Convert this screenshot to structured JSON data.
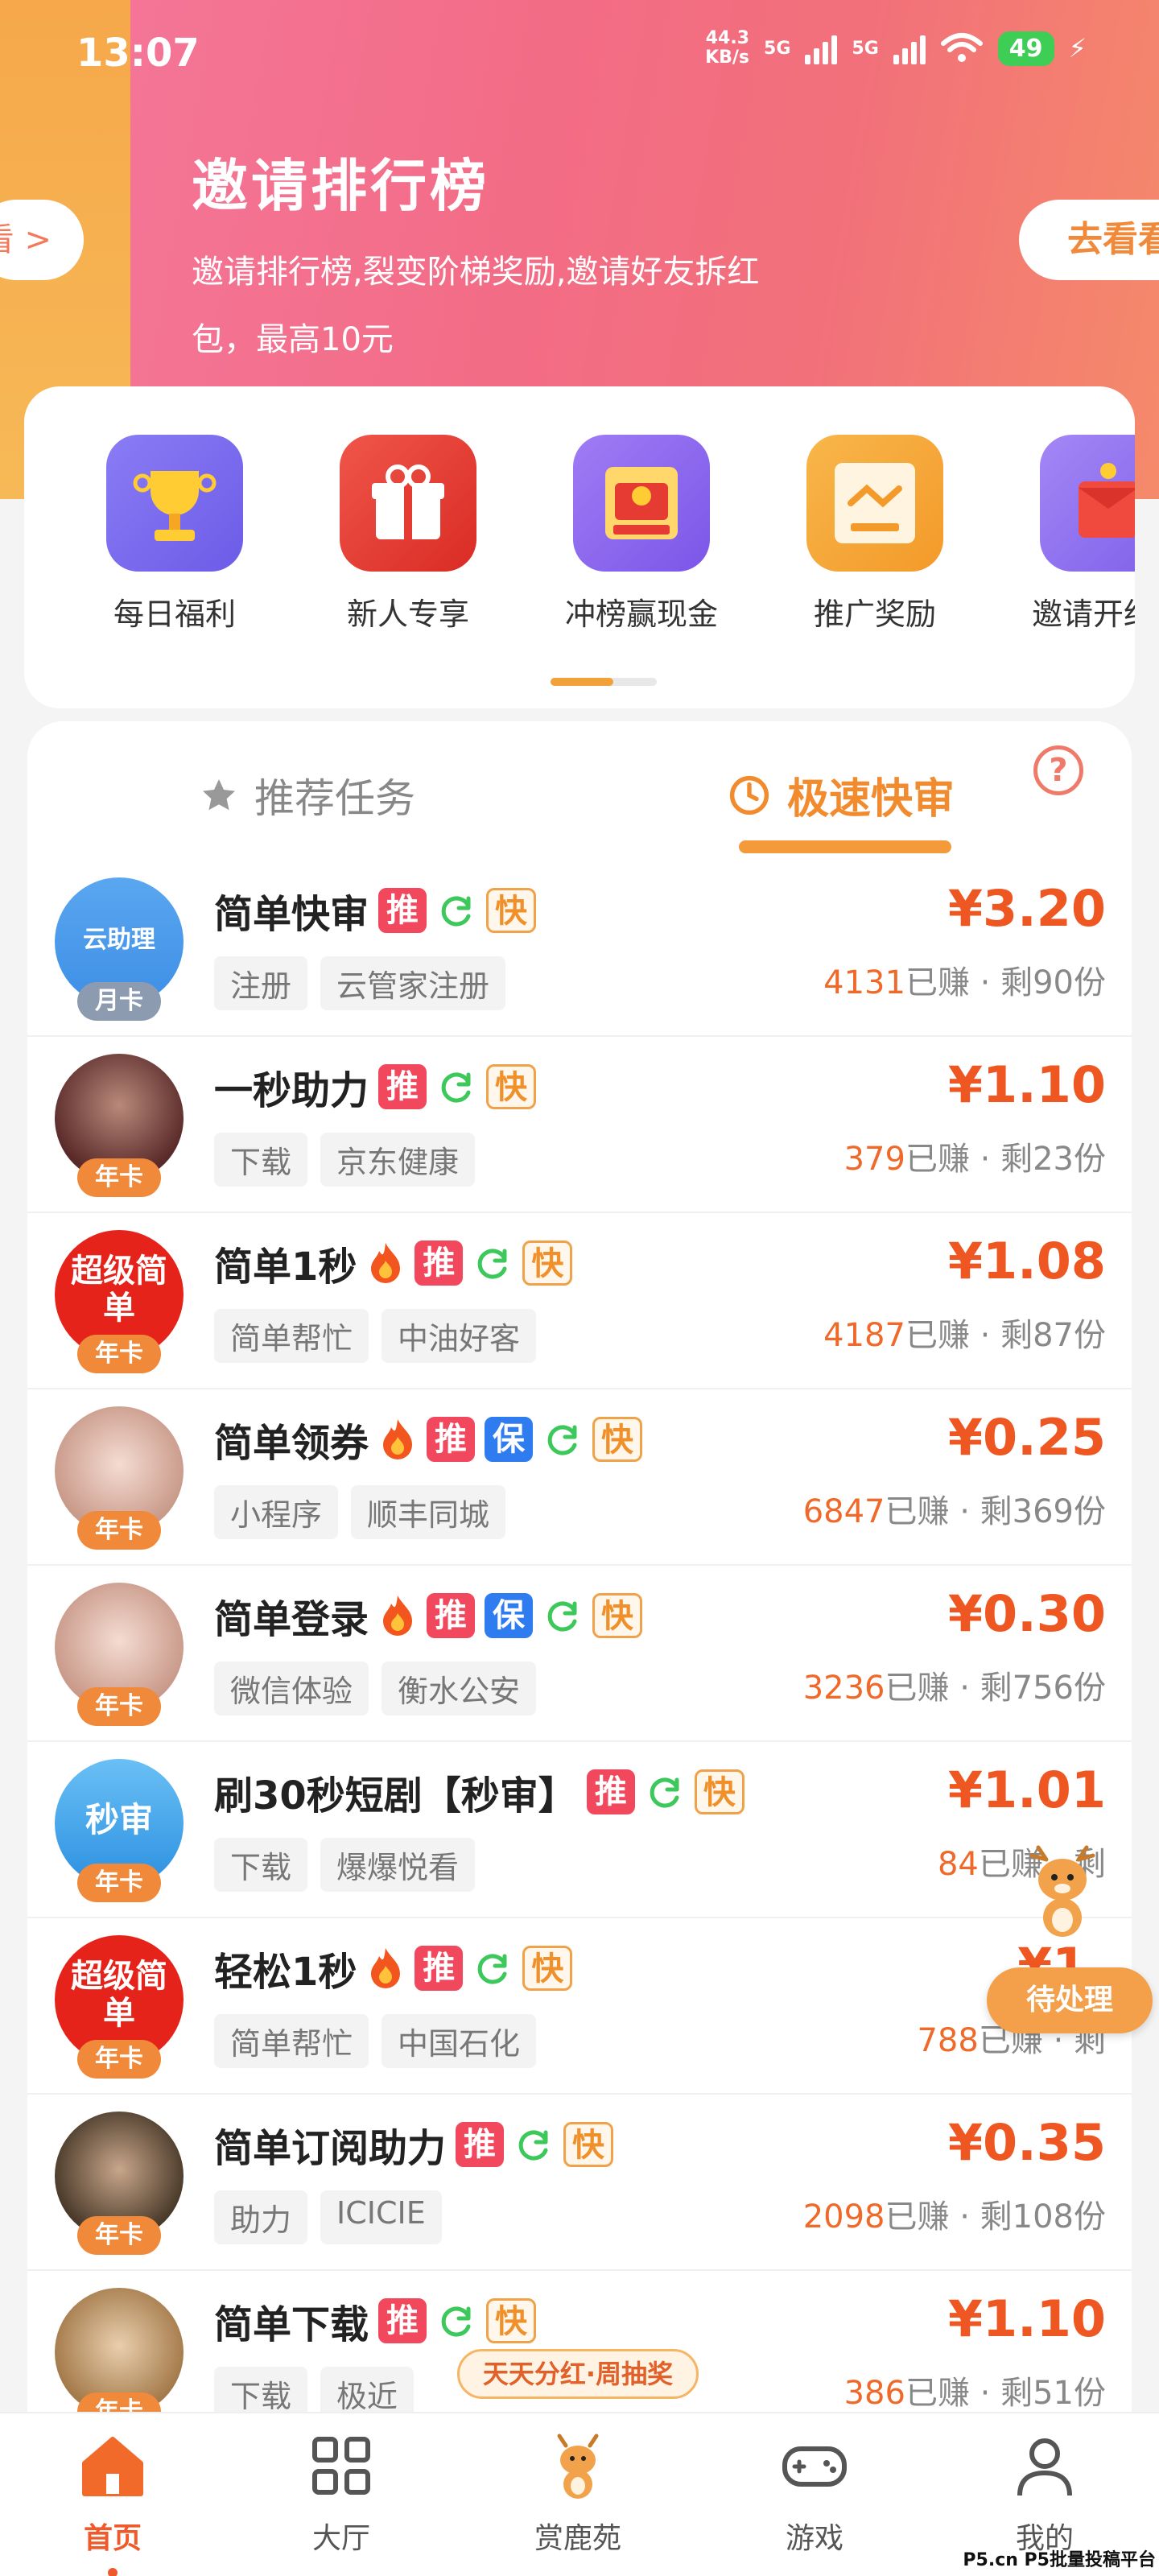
{
  "status_bar": {
    "time": "13:07",
    "net_speed_value": "44.3",
    "net_speed_unit": "KB/s",
    "sig1": "5G",
    "sig2": "5G",
    "battery": "49"
  },
  "banner": {
    "title": "邀请排行榜",
    "subtitle": "邀请排行榜,裂变阶梯奖励,邀请好友拆红包，最高10元",
    "peek_left": "看 >",
    "peek_right": "去看看"
  },
  "shortcuts": [
    {
      "label": "每日福利",
      "icon": "trophy-icon",
      "color": "#7b6cf0"
    },
    {
      "label": "新人专享",
      "icon": "gift-icon",
      "color": "#e63b33"
    },
    {
      "label": "冲榜赢现金",
      "icon": "red-envelope-icon",
      "color": "#8a5cf0"
    },
    {
      "label": "推广奖励",
      "icon": "handshake-icon",
      "color": "#f6a23a"
    },
    {
      "label": "邀请开红包",
      "icon": "invite-envelope-icon",
      "color": "#8f6af2"
    }
  ],
  "tabs": {
    "recommended": "推荐任务",
    "fast": "极速快审",
    "help": "?"
  },
  "tasks": [
    {
      "name": "简单快审",
      "fire": false,
      "bao": false,
      "tags": [
        "注册",
        "云管家注册"
      ],
      "price": "¥3.20",
      "earned": "4131",
      "earned_label": "已赚",
      "remain": "· 剩90份",
      "card": "月卡",
      "avatar_text": "云助理"
    },
    {
      "name": "一秒助力",
      "fire": false,
      "bao": false,
      "tags": [
        "下载",
        "京东健康"
      ],
      "price": "¥1.10",
      "earned": "379",
      "earned_label": "已赚",
      "remain": "· 剩23份",
      "card": "年卡",
      "avatar_text": ""
    },
    {
      "name": "简单1秒",
      "fire": true,
      "bao": false,
      "tags": [
        "简单帮忙",
        "中油好客"
      ],
      "price": "¥1.08",
      "earned": "4187",
      "earned_label": "已赚",
      "remain": "· 剩87份",
      "card": "年卡",
      "avatar_text": "超级简单"
    },
    {
      "name": "简单领券",
      "fire": true,
      "bao": true,
      "tags": [
        "小程序",
        "顺丰同城"
      ],
      "price": "¥0.25",
      "earned": "6847",
      "earned_label": "已赚",
      "remain": "· 剩369份",
      "card": "年卡",
      "avatar_text": ""
    },
    {
      "name": "简单登录",
      "fire": true,
      "bao": true,
      "tags": [
        "微信体验",
        "衡水公安"
      ],
      "price": "¥0.30",
      "earned": "3236",
      "earned_label": "已赚",
      "remain": "· 剩756份",
      "card": "年卡",
      "avatar_text": ""
    },
    {
      "name": "刷30秒短剧【秒审】",
      "fire": false,
      "bao": false,
      "tags": [
        "下载",
        "爆爆悦看"
      ],
      "price": "¥1.01",
      "earned": "84",
      "earned_label": "已赚",
      "remain": "· 剩",
      "card": "年卡",
      "avatar_text": "秒审"
    },
    {
      "name": "轻松1秒",
      "fire": true,
      "bao": false,
      "tags": [
        "简单帮忙",
        "中国石化"
      ],
      "price": "¥1.",
      "earned": "788",
      "earned_label": "已赚",
      "remain": "· 剩",
      "card": "年卡",
      "avatar_text": "超级简单"
    },
    {
      "name": "简单订阅助力",
      "fire": false,
      "bao": false,
      "tags": [
        "助力",
        "ICICIE"
      ],
      "price": "¥0.35",
      "earned": "2098",
      "earned_label": "已赚",
      "remain": "· 剩108份",
      "card": "年卡",
      "avatar_text": ""
    },
    {
      "name": "简单下载",
      "fire": false,
      "bao": false,
      "tags": [
        "下载",
        "极近"
      ],
      "price": "¥1.10",
      "earned": "386",
      "earned_label": "已赚",
      "remain": "· 剩51份",
      "card": "年卡",
      "avatar_text": ""
    }
  ],
  "tag_labels": {
    "tui": "推",
    "bao": "保",
    "kuai": "快"
  },
  "floating": {
    "pending": "待处理",
    "promo": "天天分红·周抽奖"
  },
  "bottom_nav": [
    {
      "label": "首页",
      "icon": "home-icon",
      "active": true
    },
    {
      "label": "大厅",
      "icon": "grid-icon",
      "active": false
    },
    {
      "label": "赏鹿苑",
      "icon": "deer-icon",
      "active": false
    },
    {
      "label": "游戏",
      "icon": "gamepad-icon",
      "active": false
    },
    {
      "label": "我的",
      "icon": "user-icon",
      "active": false
    }
  ],
  "watermark": "P5.cn P5批量投稿平台",
  "colors": {
    "accent": "#ef5722",
    "tab_active": "#f28a2e",
    "tui": "#f2485e",
    "bao": "#2f7cf0"
  }
}
